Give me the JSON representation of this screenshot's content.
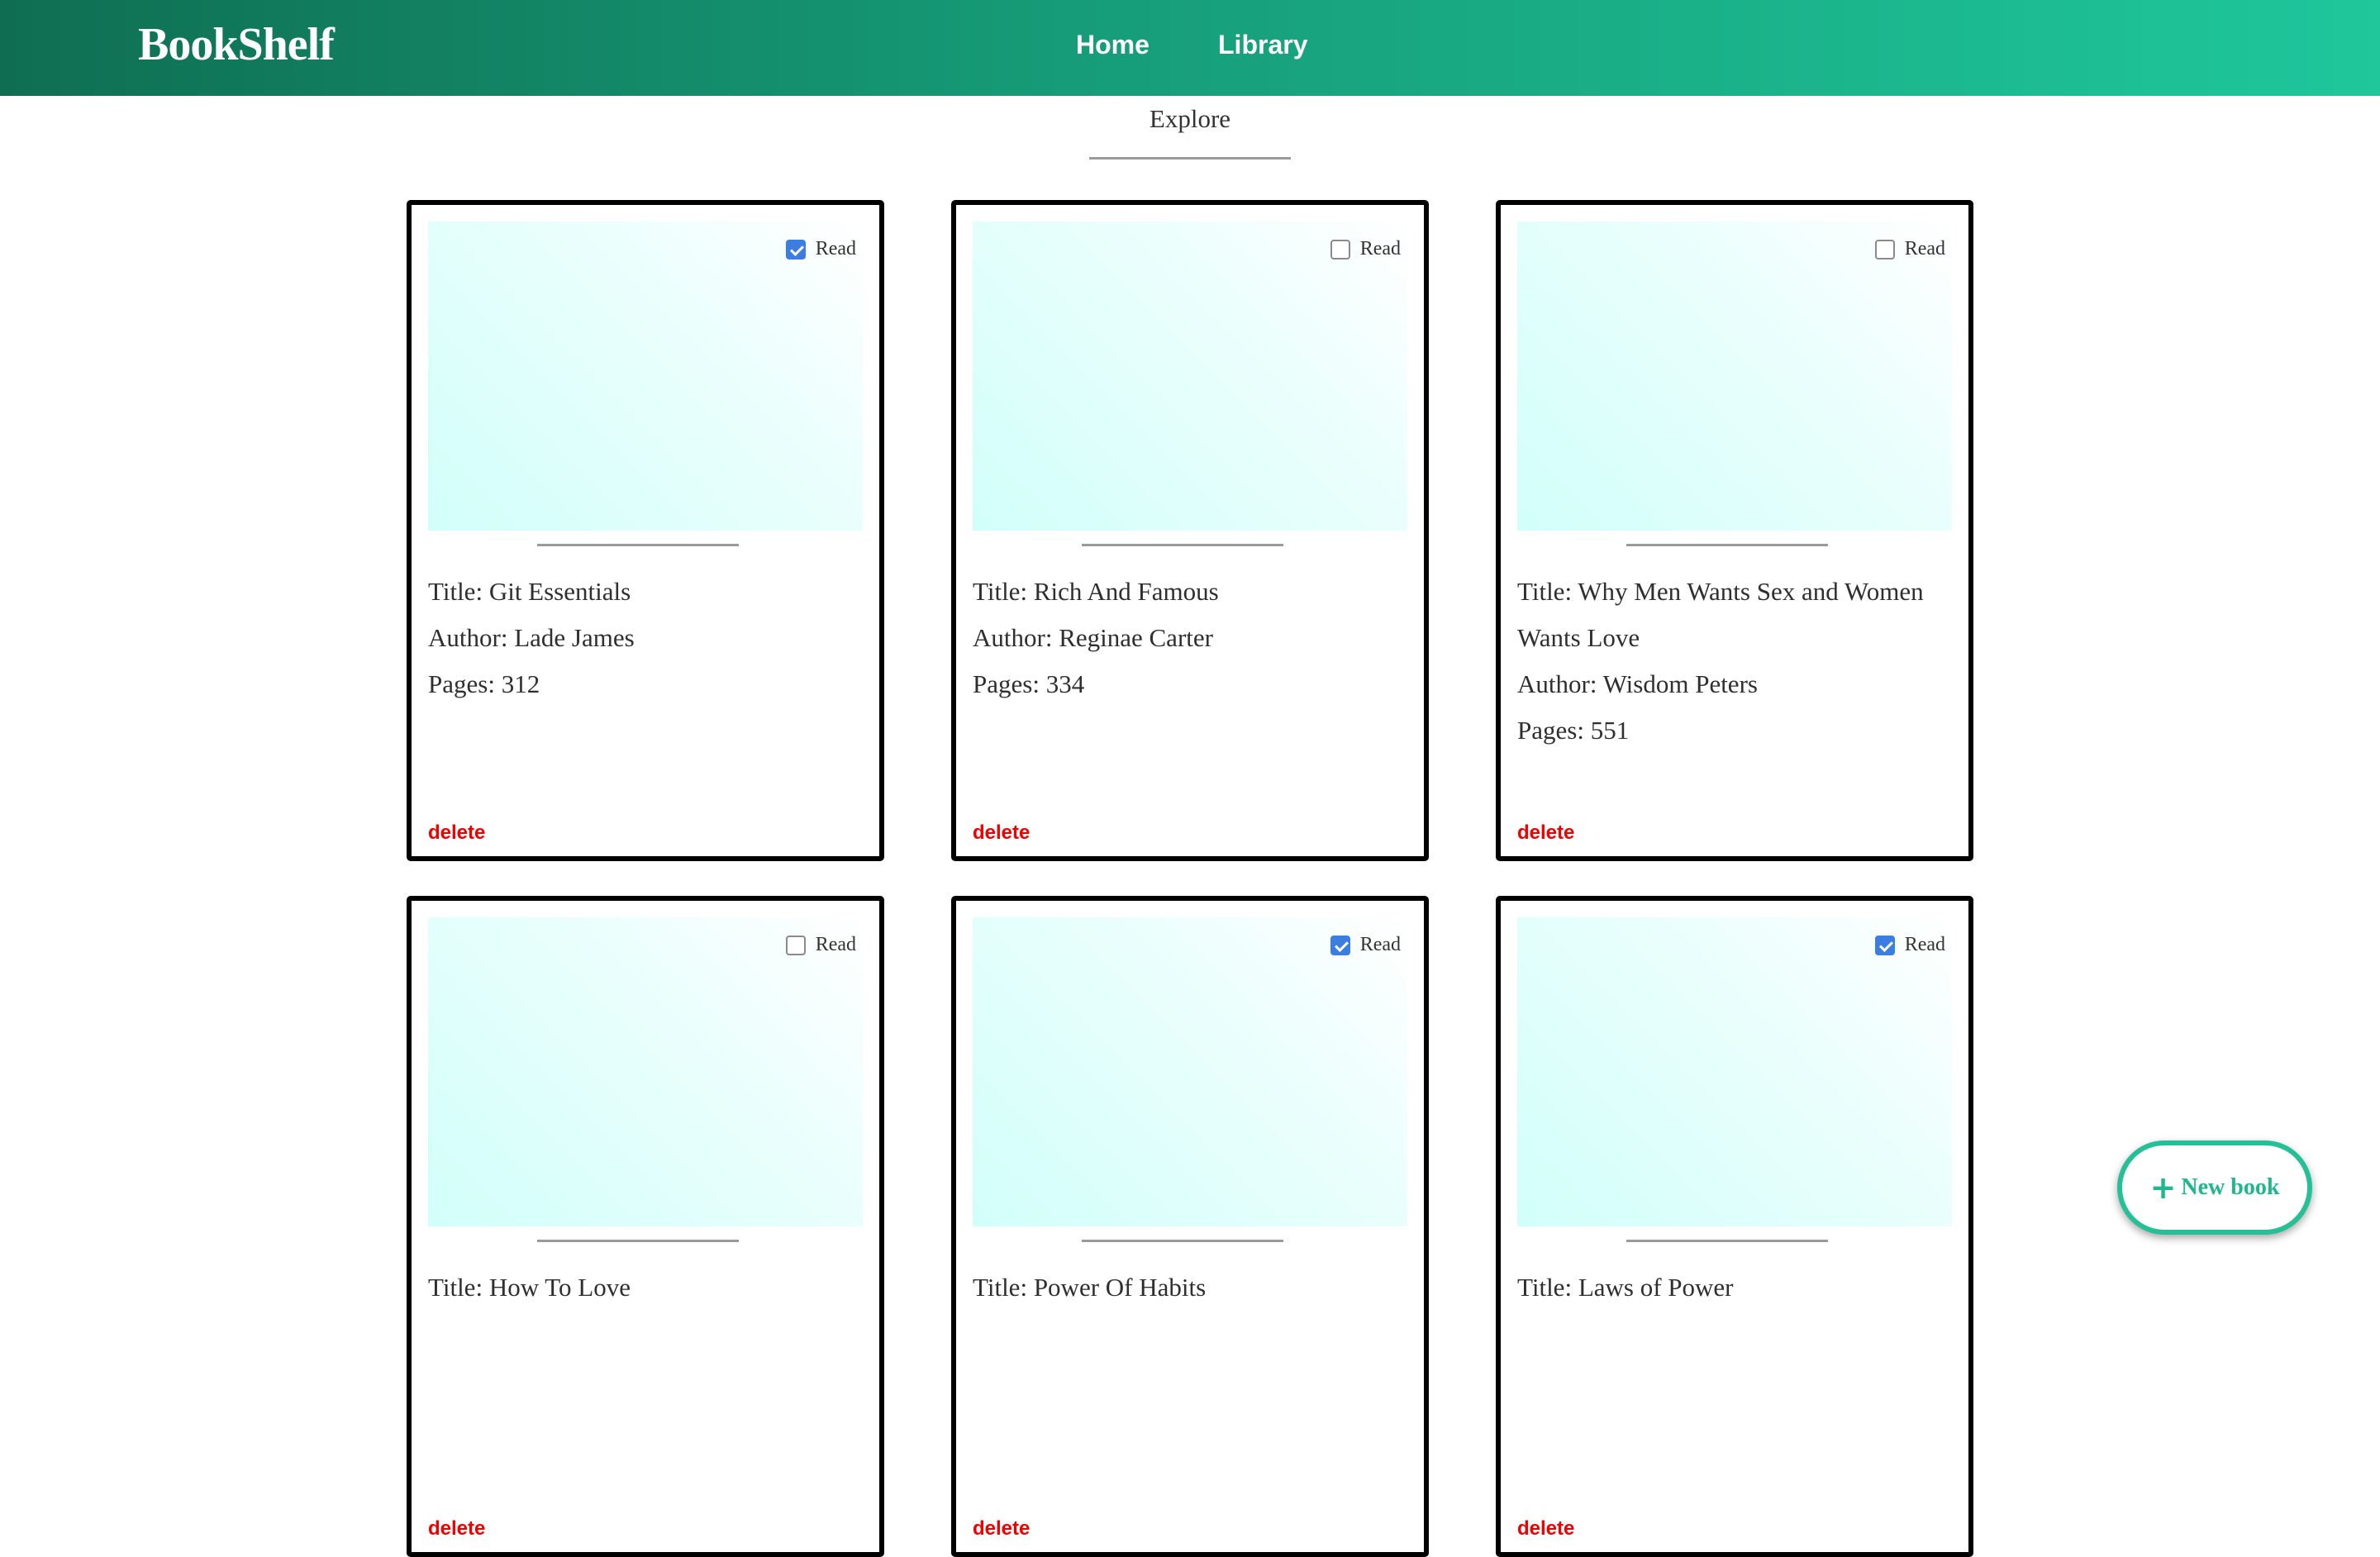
{
  "brand": "BookShelf",
  "nav": {
    "home": "Home",
    "library": "Library"
  },
  "section": {
    "title": "Explore"
  },
  "labels": {
    "read": "Read",
    "title_prefix": "Title: ",
    "author_prefix": "Author: ",
    "pages_prefix": "Pages: ",
    "delete": "delete"
  },
  "books": [
    {
      "title": "Git Essentials",
      "author": "Lade James",
      "pages": "312",
      "read": true
    },
    {
      "title": "Rich And Famous",
      "author": "Reginae Carter",
      "pages": "334",
      "read": false
    },
    {
      "title": "Why Men Wants Sex and Women Wants Love",
      "author": "Wisdom Peters",
      "pages": "551",
      "read": false
    },
    {
      "title": "How To Love",
      "author": "",
      "pages": "",
      "read": false
    },
    {
      "title": "Power Of Habits",
      "author": "",
      "pages": "",
      "read": true
    },
    {
      "title": "Laws of Power",
      "author": "",
      "pages": "",
      "read": true
    }
  ],
  "fab": {
    "icon": "plus-icon",
    "label": "New book"
  },
  "colors": {
    "nav_gradient_start": "#0f6e52",
    "nav_gradient_end": "#1fc79b",
    "checkbox_checked": "#3b7de0",
    "delete": "#f20000",
    "fab_accent": "#25c096"
  }
}
